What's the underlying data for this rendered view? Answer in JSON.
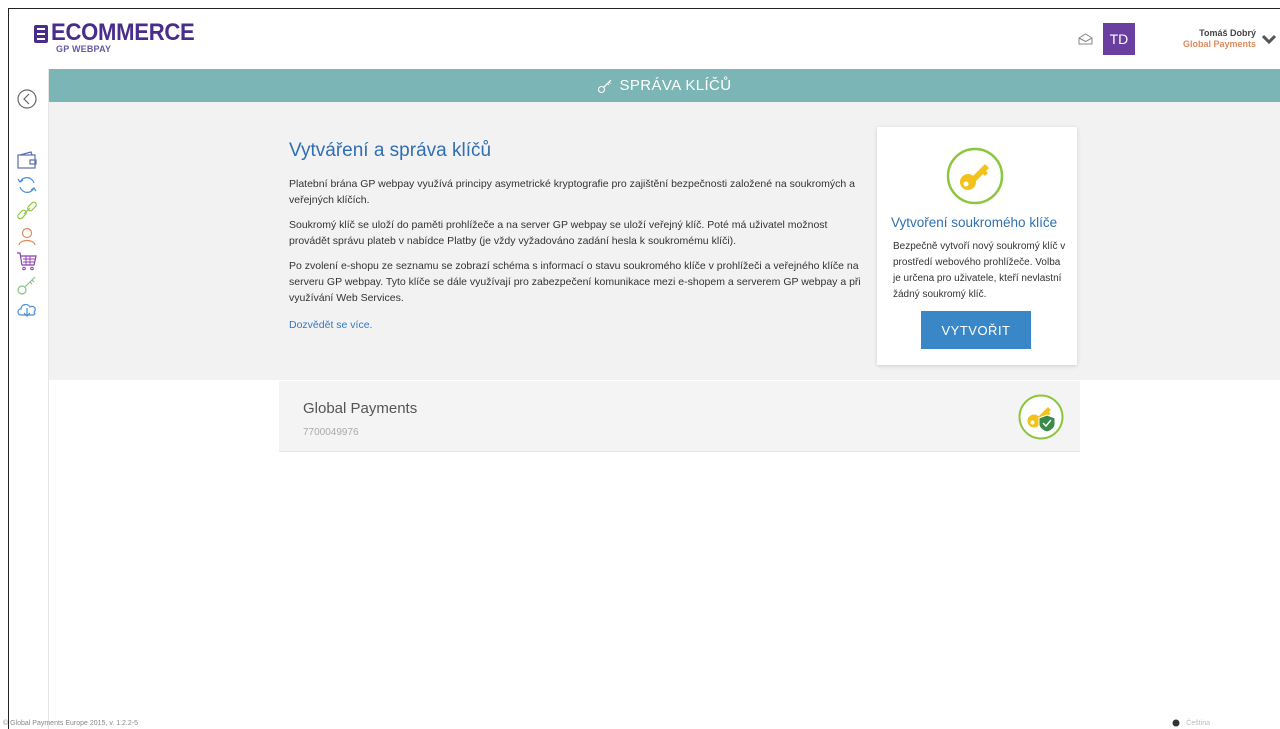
{
  "header": {
    "logo_text": "ECOMMERCE",
    "logo_sub": "GP WEBPAY",
    "avatar_initials": "TD",
    "user_name": "Tomáš Dobrý",
    "user_company": "Global Payments"
  },
  "page": {
    "title": "SPRÁVA KLÍČŮ"
  },
  "intro": {
    "heading": "Vytváření a správa klíčů",
    "paragraphs": [
      "Platební brána GP webpay využívá principy asymetrické kryptografie pro zajištění bezpečnosti založené na soukromých a veřejných klíčích.",
      "Soukromý klíč se uloží do paměti prohlížeče a na server GP webpay se uloží veřejný klíč. Poté má uživatel možnost provádět správu plateb v nabídce Platby (je vždy vyžadováno zadání hesla k soukromému klíči).",
      "Po zvolení e-shopu ze seznamu se zobrazí schéma s informací o stavu soukromého klíče v prohlížeči a veřejného klíče na serveru GP webpay. Tyto klíče se dále využívají pro zabezpečení komunikace mezi e-shopem a serverem GP webpay a při využívání Web Services."
    ],
    "link": "Dozvědět se více."
  },
  "card": {
    "title": "Vytvoření soukromého klíče",
    "description": "Bezpečně vytvoří nový soukromý klíč v prostředí webového prohlížeče. Volba je určena pro uživatele, kteří nevlastní žádný soukromý klíč.",
    "button": "VYTVOŘIT"
  },
  "merchant": {
    "name": "Global Payments",
    "id": "7700049976"
  },
  "footer": {
    "copyright": "© Global Payments Europe 2015, v. 1.2.2-5",
    "language": "Čeština"
  },
  "colors": {
    "brand": "#4a2d8b",
    "titlebar": "#7bb5b5",
    "link": "#2f6fb3",
    "button": "#3a87c8",
    "avatar": "#6b3fa0",
    "company": "#e08a5c",
    "key_yellow": "#f2c21b",
    "key_ring": "#8cc63f"
  },
  "icons": {
    "sidebar": [
      "back-circle-icon",
      "wallet-icon",
      "refresh-icon",
      "link-icon",
      "user-icon",
      "cart-icon",
      "key-icon",
      "cloud-download-icon"
    ]
  }
}
